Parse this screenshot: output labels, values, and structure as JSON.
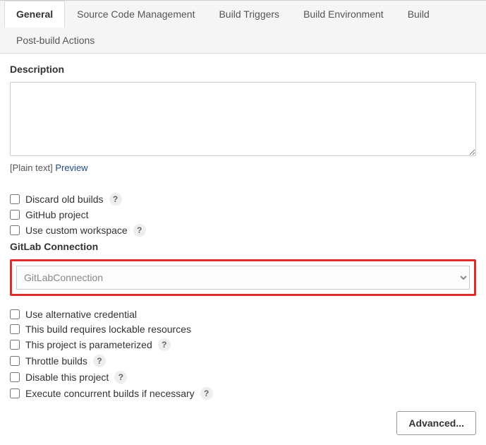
{
  "tabs": {
    "general": "General",
    "scm": "Source Code Management",
    "triggers": "Build Triggers",
    "env": "Build Environment",
    "build": "Build",
    "post": "Post-build Actions"
  },
  "description": {
    "label": "Description",
    "value": "",
    "plain_text": "[Plain text]",
    "preview": "Preview"
  },
  "checkboxes_top": {
    "discard": "Discard old builds",
    "github": "GitHub project",
    "workspace": "Use custom workspace"
  },
  "gitlab": {
    "label": "GitLab Connection",
    "selected": "GitLabConnection"
  },
  "checkboxes_bottom": {
    "alt_cred": "Use alternative credential",
    "lockable": "This build requires lockable resources",
    "parameterized": "This project is parameterized",
    "throttle": "Throttle builds",
    "disable": "Disable this project",
    "concurrent": "Execute concurrent builds if necessary"
  },
  "help_glyph": "?",
  "advanced_label": "Advanced..."
}
